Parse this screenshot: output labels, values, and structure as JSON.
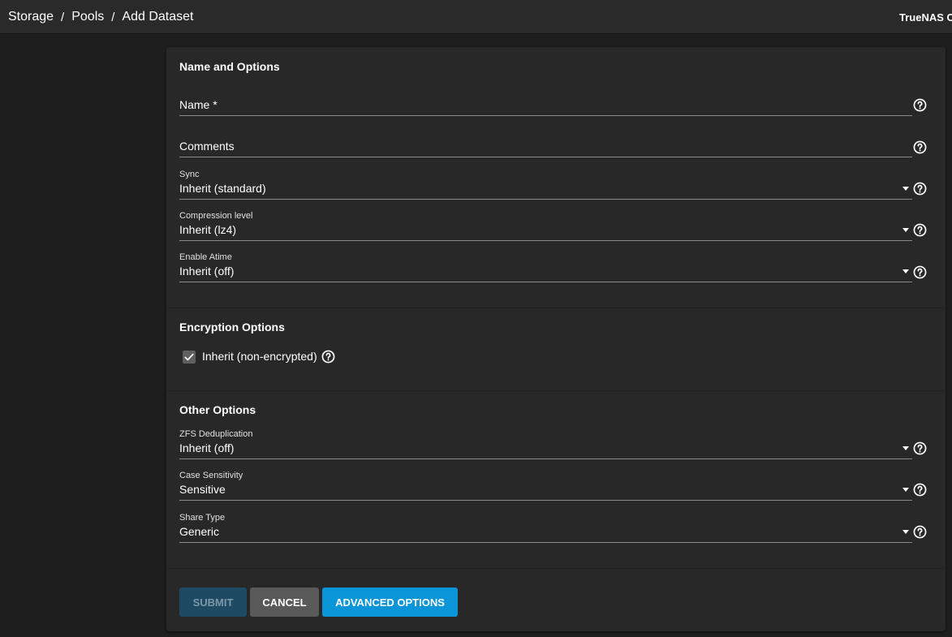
{
  "breadcrumb": {
    "items": [
      "Storage",
      "Pools",
      "Add Dataset"
    ],
    "separator": "/"
  },
  "brand": "TrueNAS C",
  "sections": {
    "name_options": {
      "title": "Name and Options",
      "name_placeholder": "Name *",
      "comments_placeholder": "Comments",
      "sync": {
        "label": "Sync",
        "value": "Inherit (standard)"
      },
      "compression": {
        "label": "Compression level",
        "value": "Inherit (lz4)"
      },
      "atime": {
        "label": "Enable Atime",
        "value": "Inherit (off)"
      }
    },
    "encryption": {
      "title": "Encryption Options",
      "inherit_label": "Inherit (non-encrypted)",
      "inherit_checked": true
    },
    "other": {
      "title": "Other Options",
      "dedup": {
        "label": "ZFS Deduplication",
        "value": "Inherit (off)"
      },
      "case": {
        "label": "Case Sensitivity",
        "value": "Sensitive"
      },
      "share": {
        "label": "Share Type",
        "value": "Generic"
      }
    }
  },
  "buttons": {
    "submit": "SUBMIT",
    "cancel": "CANCEL",
    "advanced": "ADVANCED OPTIONS"
  },
  "icons": {
    "help": "help-circle-icon",
    "dropdown": "arrow-drop-down-icon",
    "check": "check-icon"
  },
  "colors": {
    "accent": "#0a95d8",
    "submit_disabled_bg": "#1e4a63",
    "cancel_bg": "#595959",
    "card_bg": "#282828",
    "page_bg": "#1e1e1e"
  }
}
